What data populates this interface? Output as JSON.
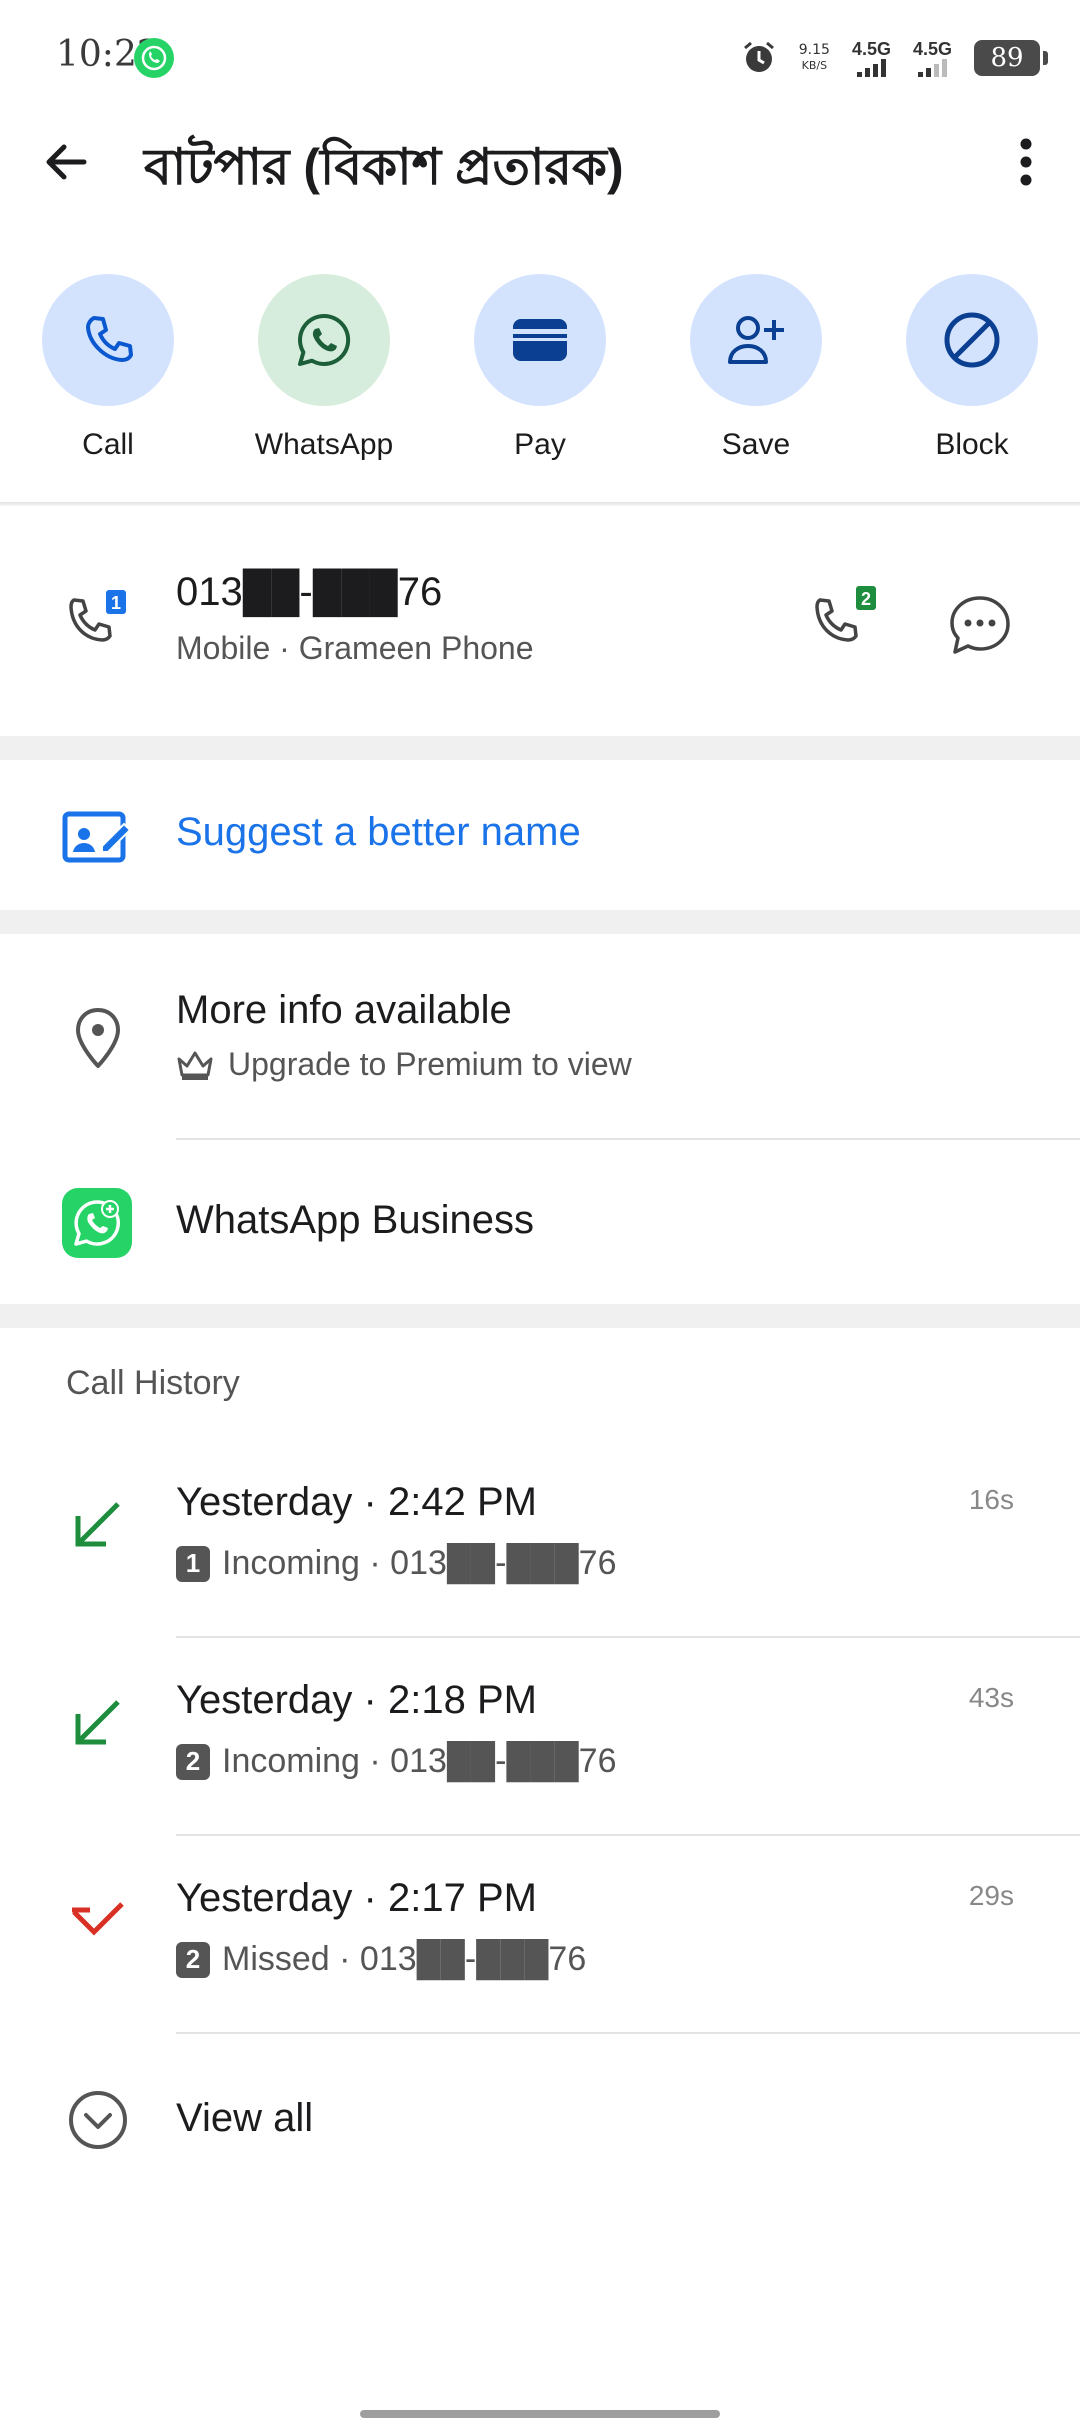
{
  "status_bar": {
    "time": "10:22",
    "net_speed_value": "9.15",
    "net_speed_unit": "KB/S",
    "network1": "4.5G",
    "network2": "4.5G",
    "battery": "89"
  },
  "header": {
    "title": "বাটপার (বিকাশ প্রতারক)"
  },
  "actions": [
    {
      "label": "Call",
      "icon": "phone-icon"
    },
    {
      "label": "WhatsApp",
      "icon": "whatsapp-icon"
    },
    {
      "label": "Pay",
      "icon": "wallet-icon"
    },
    {
      "label": "Save",
      "icon": "add-person-icon"
    },
    {
      "label": "Block",
      "icon": "block-icon"
    }
  ],
  "number": {
    "value": "013██-███76",
    "sub": "Mobile · Grameen Phone",
    "sim1": "1",
    "sim2": "2"
  },
  "suggest": {
    "label": "Suggest a better name"
  },
  "info": {
    "title": "More info available",
    "sub": "Upgrade to Premium to view"
  },
  "whatsapp_business": {
    "label": "WhatsApp Business"
  },
  "call_history": {
    "title": "Call History",
    "items": [
      {
        "time": "Yesterday · 2:42 PM",
        "sim": "1",
        "detail": "Incoming · 013██-███76",
        "duration": "16s",
        "type": "incoming"
      },
      {
        "time": "Yesterday · 2:18 PM",
        "sim": "2",
        "detail": "Incoming · 013██-███76",
        "duration": "43s",
        "type": "incoming"
      },
      {
        "time": "Yesterday · 2:17 PM",
        "sim": "2",
        "detail": "Missed · 013██-███76",
        "duration": "29s",
        "type": "missed"
      }
    ],
    "view_all": "View all"
  },
  "colors": {
    "accent": "#1a73e8",
    "incoming": "#1e8e3e",
    "missed": "#d93025",
    "action_bg": "#d3e3fd",
    "whatsapp_bg": "#d6ecdc"
  }
}
